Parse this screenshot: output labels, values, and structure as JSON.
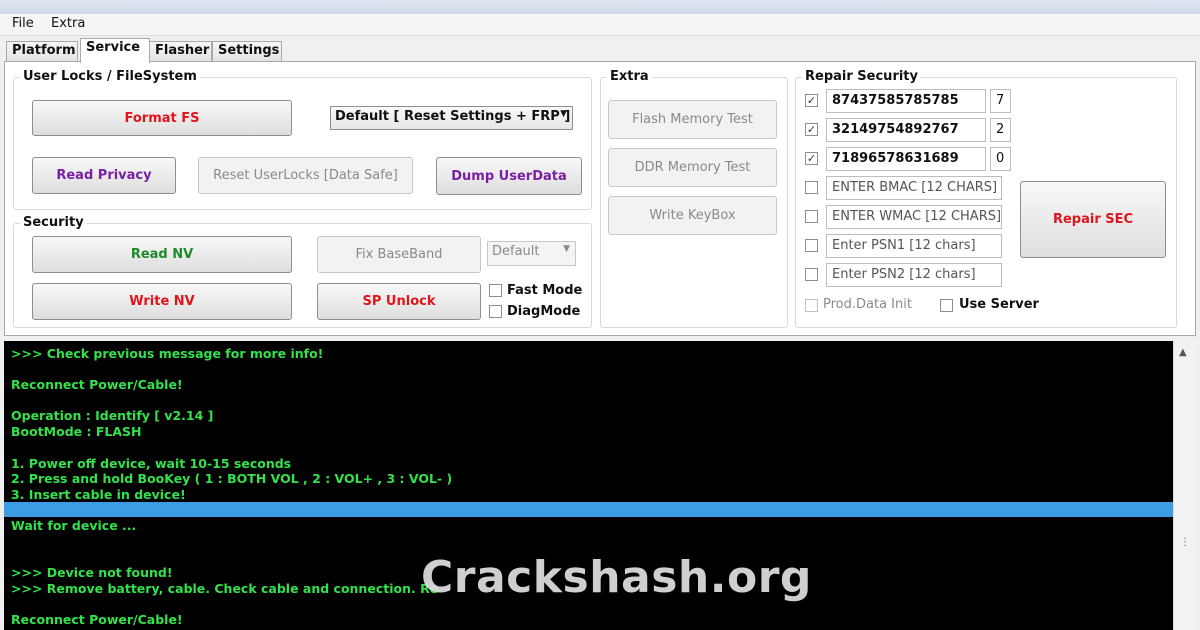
{
  "menu": {
    "file": "File",
    "extra": "Extra"
  },
  "tabs": [
    "Platform",
    "Service",
    "Flasher",
    "Settings"
  ],
  "user_locks": {
    "title": "User Locks  / FileSystem",
    "format_fs": "Format FS",
    "mode_select": "Default [ Reset Settings + FRP ]",
    "read_privacy": "Read Privacy",
    "reset_userlocks": "Reset UserLocks [Data Safe]",
    "dump_userdata": "Dump UserData"
  },
  "security": {
    "title": "Security",
    "read_nv": "Read NV",
    "fix_baseband": "Fix BaseBand",
    "baseband_select": "Default",
    "write_nv": "Write NV",
    "sp_unlock": "SP Unlock",
    "fast_mode": "Fast Mode",
    "diag_mode": "DiagMode"
  },
  "extra": {
    "title": "Extra",
    "flash_memory_test": "Flash Memory Test",
    "ddr_memory_test": "DDR Memory Test",
    "write_keybox": "Write KeyBox"
  },
  "repair_security": {
    "title": "Repair Security",
    "rows": [
      {
        "value": "87437585785785",
        "index": "7",
        "checked": "✓"
      },
      {
        "value": "32149754892767",
        "index": "2",
        "checked": "✓"
      },
      {
        "value": "71896578631689",
        "index": "0",
        "checked": "✓"
      },
      {
        "value": "ENTER BMAC [12 CHARS]",
        "checked": ""
      },
      {
        "value": "ENTER WMAC [12 CHARS]",
        "checked": ""
      },
      {
        "value": "Enter PSN1 [12 chars]",
        "checked": ""
      },
      {
        "value": "Enter PSN2 [12 chars]",
        "checked": ""
      }
    ],
    "repair_sec": "Repair SEC",
    "prod_data_init": "Prod.Data Init",
    "use_server": "Use Server"
  },
  "console": {
    "lines": [
      ">>>  Check previous message for more info!",
      "Reconnect Power/Cable!",
      "Operation : Identify [ v2.14 ]",
      "BootMode : FLASH",
      "1. Power off device, wait 10-15 seconds",
      "2. Press and hold BooKey ( 1 : BOTH VOL , 2 : VOL+ , 3 : VOL- )",
      "3. Insert cable in device!",
      "Wait for device ...",
      ">>>  Device not found!",
      ">>>  Remove battery, cable. Check cable and connection. Re",
      "Reconnect Power/Cable!"
    ]
  },
  "watermark": "Crackshash.org",
  "colors": {
    "console_bg": "#000000",
    "console_text": "#33e24a",
    "highlight": "#3c9de5",
    "danger": "#e0141b",
    "purple": "#7b1fa2",
    "green": "#1e8a2c"
  }
}
